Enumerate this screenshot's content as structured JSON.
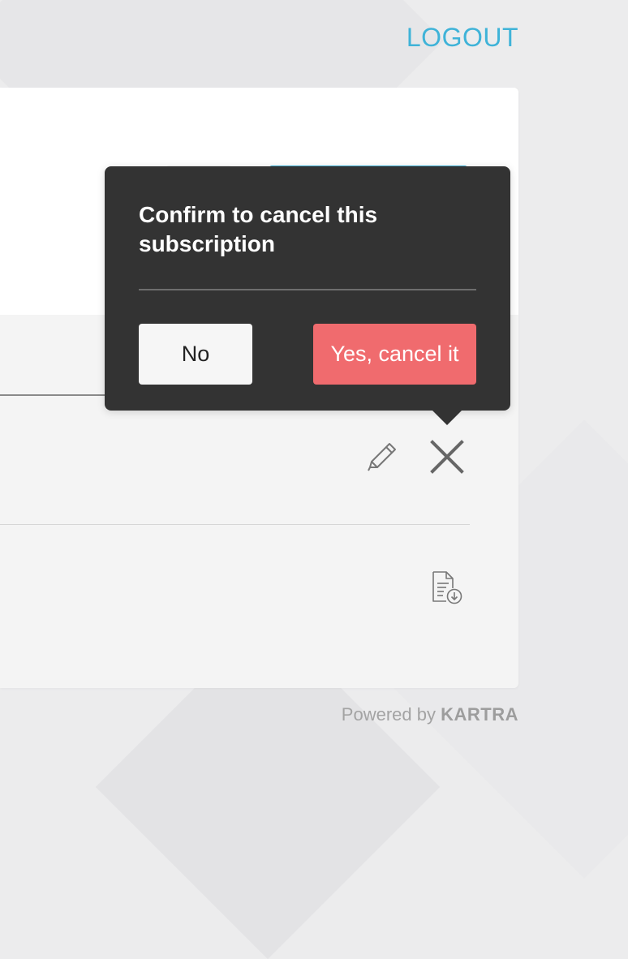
{
  "header": {
    "logout_label": "LOGOUT"
  },
  "popover": {
    "title": "Confirm to cancel this subscription",
    "no_label": "No",
    "yes_label": "Yes, cancel it"
  },
  "row": {
    "edit_icon": "pencil-icon",
    "cancel_icon": "close-icon",
    "invoice_icon": "document-download-icon"
  },
  "footer": {
    "powered_prefix": "Powered by",
    "powered_brand": "KARTRA"
  },
  "colors": {
    "accent": "#3fb3d8",
    "danger": "#f06b6e",
    "popover_bg": "#333333",
    "card_bg": "#f4f4f4"
  }
}
